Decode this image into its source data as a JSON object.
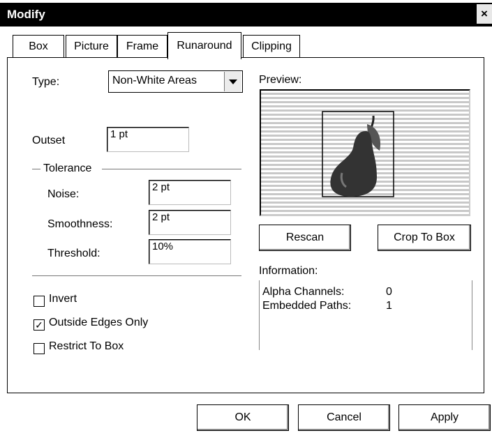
{
  "window": {
    "title": "Modify",
    "close_glyph": "×"
  },
  "tabs": [
    {
      "label": "Box"
    },
    {
      "label": "Picture"
    },
    {
      "label": "Frame"
    },
    {
      "label": "Runaround"
    },
    {
      "label": "Clipping"
    }
  ],
  "runaround": {
    "type_label": "Type:",
    "type_value": "Non-White Areas",
    "outset_label": "Outset",
    "outset_value": "1 pt",
    "tolerance_label": "Tolerance",
    "noise_label": "Noise:",
    "noise_value": "2 pt",
    "smoothness_label": "Smoothness:",
    "smoothness_value": "2 pt",
    "threshold_label": "Threshold:",
    "threshold_value": "10%",
    "checkboxes": [
      {
        "label": "Invert",
        "checked": false
      },
      {
        "label": "Outside Edges Only",
        "checked": true
      },
      {
        "label": "Restrict To Box",
        "checked": false
      }
    ],
    "check_mark": "✓"
  },
  "preview": {
    "label": "Preview:",
    "rescan_label": "Rescan",
    "crop_label": "Crop To Box"
  },
  "information": {
    "label": "Information:",
    "rows": [
      {
        "name": "Alpha Channels:",
        "value": "0"
      },
      {
        "name": "Embedded Paths:",
        "value": "1"
      }
    ]
  },
  "footer": {
    "ok_label": "OK",
    "cancel_label": "Cancel",
    "apply_label": "Apply"
  },
  "colors": {
    "titlebar": "#000000",
    "background": "#ffffff",
    "pear": "#333333"
  }
}
